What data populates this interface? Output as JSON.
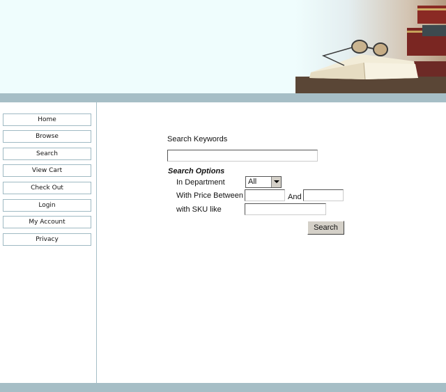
{
  "sidebar": {
    "items": [
      {
        "label": "Home"
      },
      {
        "label": "Browse"
      },
      {
        "label": "Search"
      },
      {
        "label": "View Cart"
      },
      {
        "label": "Check Out"
      },
      {
        "label": "Login"
      },
      {
        "label": "My Account"
      },
      {
        "label": "Privacy"
      }
    ]
  },
  "search": {
    "keywords_label": "Search Keywords",
    "keywords_value": "",
    "options_title": "Search Options",
    "department_label": "In Department",
    "department_selected": "All",
    "price_label": "With Price Between",
    "price_min_value": "",
    "and_label": "And",
    "price_max_value": "",
    "sku_label": "with SKU like",
    "sku_value": "",
    "submit_label": "Search"
  },
  "colors": {
    "banner_background": "#effdfd",
    "strip": "#a6bec6",
    "nav_border": "#9fb9c3"
  }
}
